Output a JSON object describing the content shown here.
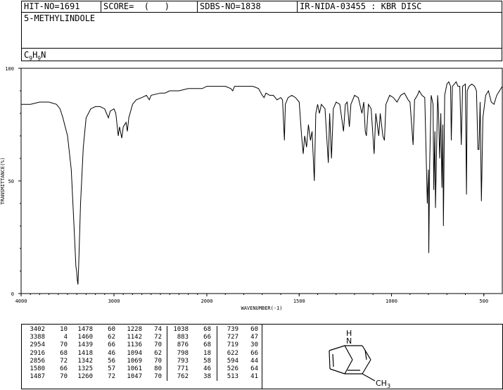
{
  "header": {
    "hit_no": "HIT-NO=1691",
    "score": "SCORE=  (   )",
    "sdbs_no": "SDBS-NO=1838",
    "ir_nida": "IR-NIDA-03455 : KBR DISC"
  },
  "compound": {
    "name": "5-METHYLINDOLE",
    "formula": {
      "C": "C",
      "c_sub": "9",
      "H": "H",
      "h_sub": "9",
      "N": "N"
    }
  },
  "chart_data": {
    "type": "line",
    "title": "",
    "xlabel": "WAVENUMBER(-1)",
    "ylabel": "TRANSMITTANCE(%)",
    "xlim": [
      4000,
      400
    ],
    "ylim": [
      0,
      100
    ],
    "x_ticks": [
      "4000",
      "3000",
      "2000",
      "1500",
      "1000",
      "500"
    ],
    "y_ticks": [
      "100",
      "50",
      "0"
    ],
    "x_reversed": true,
    "x_scale": "piecewise-linear (break at 2000)",
    "grid": false,
    "series": [
      {
        "points": [
          [
            4000,
            84
          ],
          [
            3900,
            84
          ],
          [
            3800,
            85
          ],
          [
            3700,
            85
          ],
          [
            3620,
            84
          ],
          [
            3580,
            82
          ],
          [
            3550,
            78
          ],
          [
            3500,
            70
          ],
          [
            3460,
            55
          ],
          [
            3430,
            30
          ],
          [
            3410,
            12
          ],
          [
            3402,
            10
          ],
          [
            3395,
            6
          ],
          [
            3388,
            4
          ],
          [
            3380,
            12
          ],
          [
            3360,
            40
          ],
          [
            3330,
            65
          ],
          [
            3300,
            78
          ],
          [
            3250,
            82
          ],
          [
            3200,
            83
          ],
          [
            3150,
            83
          ],
          [
            3100,
            82
          ],
          [
            3080,
            80
          ],
          [
            3060,
            78
          ],
          [
            3040,
            81
          ],
          [
            3000,
            82
          ],
          [
            2980,
            80
          ],
          [
            2954,
            70
          ],
          [
            2940,
            74
          ],
          [
            2930,
            72
          ],
          [
            2916,
            69
          ],
          [
            2900,
            74
          ],
          [
            2870,
            76
          ],
          [
            2856,
            72
          ],
          [
            2840,
            78
          ],
          [
            2800,
            84
          ],
          [
            2760,
            86
          ],
          [
            2700,
            87
          ],
          [
            2650,
            88
          ],
          [
            2620,
            86
          ],
          [
            2600,
            88
          ],
          [
            2500,
            89
          ],
          [
            2450,
            89
          ],
          [
            2400,
            90
          ],
          [
            2300,
            90
          ],
          [
            2200,
            91
          ],
          [
            2100,
            91
          ],
          [
            2050,
            91
          ],
          [
            2000,
            92
          ],
          [
            1950,
            92
          ],
          [
            1900,
            92
          ],
          [
            1870,
            91
          ],
          [
            1860,
            90
          ],
          [
            1850,
            92
          ],
          [
            1800,
            92
          ],
          [
            1750,
            92
          ],
          [
            1720,
            91
          ],
          [
            1700,
            88
          ],
          [
            1690,
            87
          ],
          [
            1680,
            89
          ],
          [
            1660,
            88
          ],
          [
            1640,
            88
          ],
          [
            1620,
            86
          ],
          [
            1600,
            87
          ],
          [
            1590,
            86
          ],
          [
            1580,
            68
          ],
          [
            1575,
            84
          ],
          [
            1560,
            87
          ],
          [
            1540,
            88
          ],
          [
            1520,
            87
          ],
          [
            1500,
            85
          ],
          [
            1487,
            70
          ],
          [
            1478,
            62
          ],
          [
            1470,
            70
          ],
          [
            1460,
            65
          ],
          [
            1450,
            75
          ],
          [
            1439,
            68
          ],
          [
            1430,
            72
          ],
          [
            1418,
            50
          ],
          [
            1410,
            80
          ],
          [
            1400,
            84
          ],
          [
            1390,
            80
          ],
          [
            1380,
            84
          ],
          [
            1360,
            82
          ],
          [
            1342,
            58
          ],
          [
            1335,
            80
          ],
          [
            1325,
            60
          ],
          [
            1315,
            82
          ],
          [
            1300,
            85
          ],
          [
            1280,
            84
          ],
          [
            1260,
            72
          ],
          [
            1250,
            84
          ],
          [
            1240,
            85
          ],
          [
            1228,
            74
          ],
          [
            1220,
            84
          ],
          [
            1200,
            88
          ],
          [
            1180,
            87
          ],
          [
            1160,
            80
          ],
          [
            1150,
            85
          ],
          [
            1142,
            72
          ],
          [
            1136,
            70
          ],
          [
            1125,
            84
          ],
          [
            1110,
            82
          ],
          [
            1094,
            62
          ],
          [
            1085,
            80
          ],
          [
            1069,
            70
          ],
          [
            1061,
            80
          ],
          [
            1047,
            70
          ],
          [
            1038,
            68
          ],
          [
            1030,
            84
          ],
          [
            1010,
            88
          ],
          [
            990,
            87
          ],
          [
            970,
            85
          ],
          [
            950,
            88
          ],
          [
            930,
            89
          ],
          [
            910,
            86
          ],
          [
            900,
            85
          ],
          [
            883,
            66
          ],
          [
            875,
            86
          ],
          [
            860,
            88
          ],
          [
            850,
            90
          ],
          [
            835,
            88
          ],
          [
            820,
            87
          ],
          [
            806,
            40
          ],
          [
            800,
            55
          ],
          [
            798,
            18
          ],
          [
            793,
            58
          ],
          [
            785,
            88
          ],
          [
            775,
            84
          ],
          [
            771,
            46
          ],
          [
            765,
            72
          ],
          [
            762,
            38
          ],
          [
            750,
            88
          ],
          [
            745,
            80
          ],
          [
            739,
            60
          ],
          [
            733,
            80
          ],
          [
            727,
            47
          ],
          [
            722,
            75
          ],
          [
            719,
            30
          ],
          [
            712,
            88
          ],
          [
            700,
            93
          ],
          [
            690,
            94
          ],
          [
            680,
            92
          ],
          [
            676,
            68
          ],
          [
            670,
            92
          ],
          [
            660,
            93
          ],
          [
            650,
            94
          ],
          [
            640,
            92
          ],
          [
            630,
            92
          ],
          [
            622,
            66
          ],
          [
            615,
            92
          ],
          [
            600,
            93
          ],
          [
            594,
            44
          ],
          [
            590,
            90
          ],
          [
            580,
            92
          ],
          [
            565,
            93
          ],
          [
            550,
            92
          ],
          [
            540,
            90
          ],
          [
            532,
            64
          ],
          [
            526,
            64
          ],
          [
            520,
            85
          ],
          [
            513,
            41
          ],
          [
            505,
            78
          ],
          [
            490,
            88
          ],
          [
            475,
            90
          ],
          [
            460,
            85
          ],
          [
            445,
            84
          ],
          [
            430,
            88
          ],
          [
            415,
            90
          ],
          [
            400,
            92
          ]
        ]
      }
    ]
  },
  "peak_table": {
    "columns": [
      [
        [
          "3402",
          "10"
        ],
        [
          "3388",
          "4"
        ],
        [
          "2954",
          "70"
        ],
        [
          "2916",
          "68"
        ],
        [
          "2856",
          "72"
        ],
        [
          "1580",
          "66"
        ],
        [
          "1487",
          "70"
        ]
      ],
      [
        [
          "1478",
          "60"
        ],
        [
          "1460",
          "62"
        ],
        [
          "1439",
          "66"
        ],
        [
          "1418",
          "46"
        ],
        [
          "1342",
          "56"
        ],
        [
          "1325",
          "57"
        ],
        [
          "1260",
          "72"
        ]
      ],
      [
        [
          "1228",
          "74"
        ],
        [
          "1142",
          "72"
        ],
        [
          "1136",
          "70"
        ],
        [
          "1094",
          "62"
        ],
        [
          "1069",
          "70"
        ],
        [
          "1061",
          "80"
        ],
        [
          "1047",
          "70"
        ]
      ],
      [
        [
          "1038",
          "68"
        ],
        [
          "883",
          "66"
        ],
        [
          "876",
          "68"
        ],
        [
          "798",
          "18"
        ],
        [
          "793",
          "58"
        ],
        [
          "771",
          "46"
        ],
        [
          "762",
          "38"
        ]
      ],
      [
        [
          "739",
          "60"
        ],
        [
          "727",
          "47"
        ],
        [
          "719",
          "30"
        ],
        [
          "622",
          "66"
        ],
        [
          "594",
          "44"
        ],
        [
          "526",
          "64"
        ],
        [
          "513",
          "41"
        ]
      ]
    ]
  },
  "structure": {
    "nh_label": "H",
    "n_label": "N",
    "methyl_label": "CH",
    "methyl_sub": "3"
  }
}
